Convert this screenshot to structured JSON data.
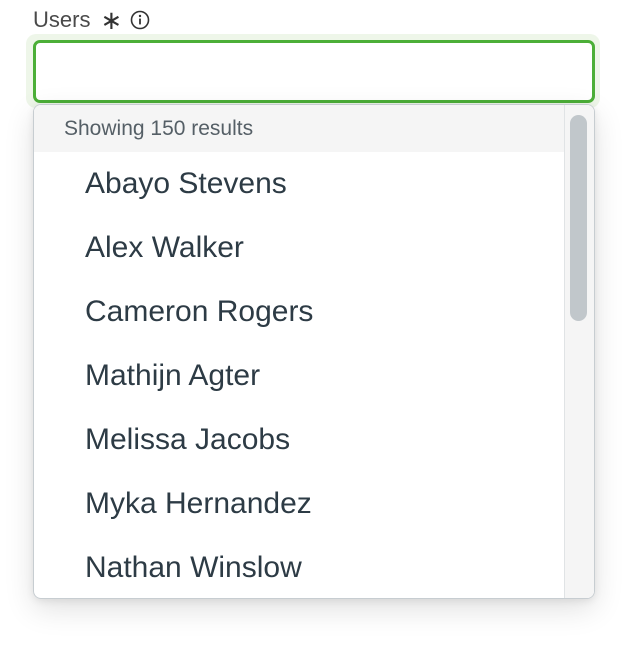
{
  "field": {
    "label": "Users",
    "required_mark": "∗",
    "info_icon": "info-circle-icon",
    "input_value": "",
    "input_placeholder": ""
  },
  "dropdown": {
    "result_count": "Showing 150 results",
    "options": [
      "Abayo Stevens",
      "Alex Walker",
      "Cameron Rogers",
      "Mathijn Agter",
      "Melissa Jacobs",
      "Myka Hernandez",
      "Nathan Winslow"
    ]
  },
  "colors": {
    "focus_border": "#4caf38",
    "focus_halo": "#eef6e9",
    "option_text": "#2d3b45",
    "scroll_thumb": "#c1c7cb"
  }
}
